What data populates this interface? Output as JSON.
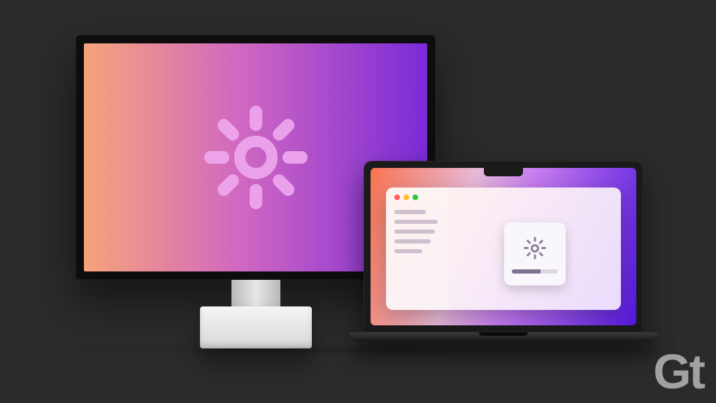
{
  "scene": {
    "description": "Illustration of an external display and a MacBook showing brightness controls",
    "background_color": "#2b2b2b"
  },
  "monitor": {
    "icon_name": "brightness-sun",
    "gradient_colors": [
      "#f6a47a",
      "#d168c1",
      "#7a2bd8"
    ]
  },
  "laptop": {
    "gradient_colors": [
      "#f97350",
      "#e8b9d8",
      "#c47af0",
      "#5418dd"
    ],
    "window": {
      "traffic_lights": [
        "close",
        "minimize",
        "zoom"
      ],
      "sidebar_items": 5,
      "hud": {
        "icon_name": "brightness-sun",
        "level_percent": 62
      }
    }
  },
  "watermark": {
    "text": "Gt"
  }
}
